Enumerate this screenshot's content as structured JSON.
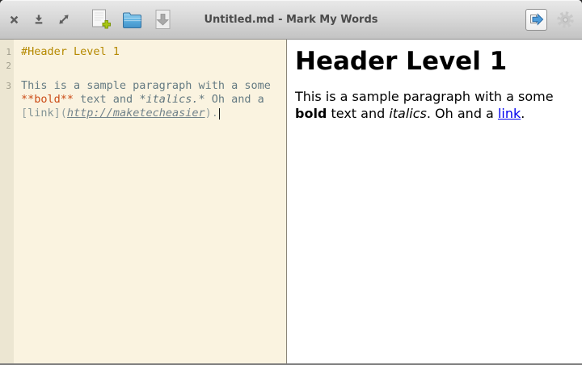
{
  "window": {
    "title": "Untitled.md - Mark My Words"
  },
  "titlebar": {
    "window_control_icons": [
      "close-icon",
      "minimize-icon",
      "maximize-icon"
    ],
    "toolbar_icons": [
      "new-document-icon",
      "folder-open-icon",
      "save-icon"
    ],
    "action_icons": [
      "export-arrow-icon",
      "gear-icon"
    ]
  },
  "colors": {
    "titlebar_top": "#e9e9e9",
    "titlebar_bottom": "#c3c3c3",
    "editor_background": "#faf3e0",
    "gutter_background": "#ece6d2",
    "syntax_header": "#b58900",
    "syntax_bold": "#cb4b16",
    "syntax_body": "#657b83",
    "link_blue": "#0000ee",
    "accent_blue": "#4f9ddb",
    "folder_blue": "#5cb0e0",
    "plus_green": "#a8c613"
  },
  "editor": {
    "line_numbers": [
      "1",
      "2",
      "3"
    ],
    "line1_header": "#Header Level 1",
    "line3_text": "This is a sample paragraph with a some",
    "line4": {
      "bold": "**bold**",
      "mid": " text and ",
      "italic": "*italics.*",
      "end": " Oh and a"
    },
    "line5": {
      "open_bracket": "[",
      "link_label": "link",
      "close_bracket": "](",
      "url": "http://maketecheasier",
      "close_paren": ")."
    }
  },
  "preview": {
    "heading": "Header Level 1",
    "para": {
      "t1": "This is a sample paragraph with a some ",
      "bold": "bold",
      "t2": " text and ",
      "italic": "italics",
      "t3": ". Oh and a ",
      "link": "link",
      "t4": "."
    }
  }
}
